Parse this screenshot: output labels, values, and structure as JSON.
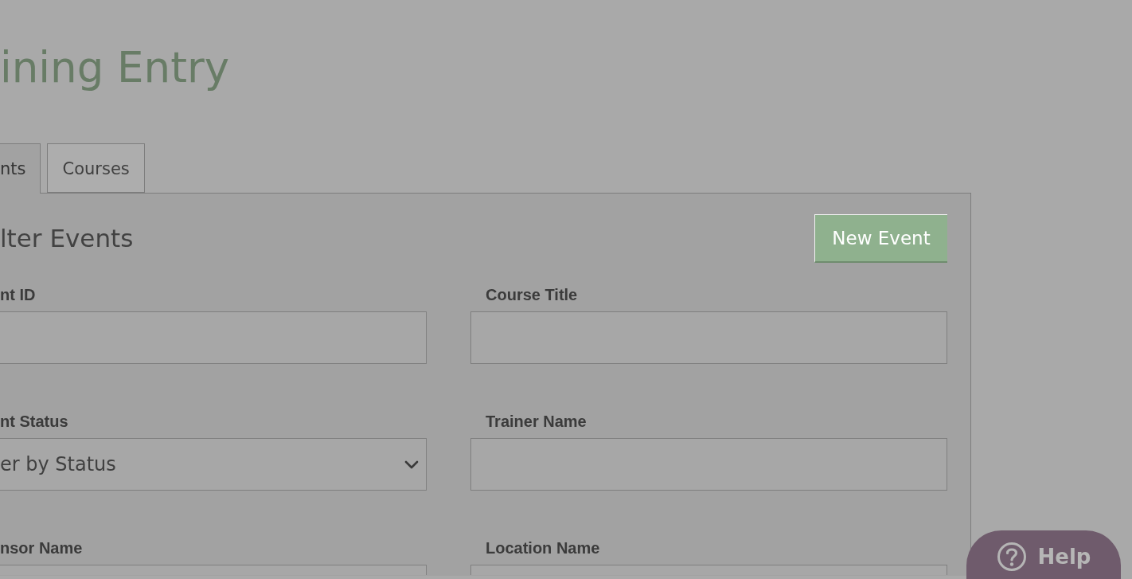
{
  "page": {
    "title": "ining Entry"
  },
  "tabs": [
    {
      "label": "nts",
      "selected": true
    },
    {
      "label": "Courses",
      "selected": false
    }
  ],
  "panel": {
    "heading": "lter Events",
    "new_button": "New Event",
    "fields": [
      {
        "label": "nt ID",
        "kind": "text"
      },
      {
        "label": "Course Title",
        "kind": "text"
      },
      {
        "label": "nt Status",
        "kind": "select",
        "value": "er by Status"
      },
      {
        "label": "Trainer Name",
        "kind": "text"
      },
      {
        "label": "nsor Name",
        "kind": "text"
      },
      {
        "label": "Location Name",
        "kind": "text"
      }
    ]
  },
  "help_button": {
    "label": "Help"
  }
}
